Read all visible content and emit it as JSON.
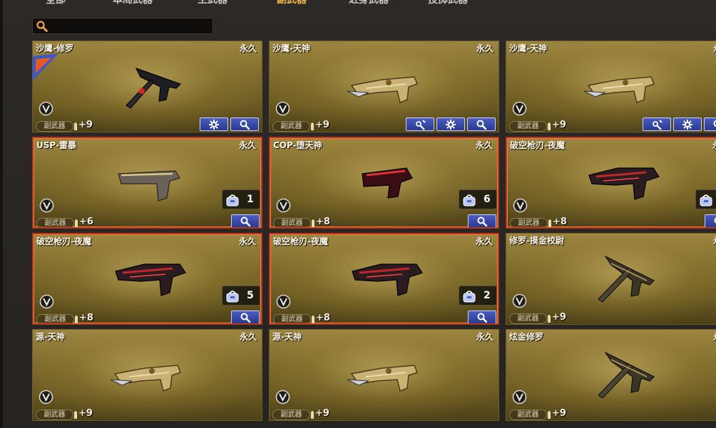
{
  "tabs": [
    {
      "label": "全部",
      "active": false
    },
    {
      "label": "本局武器",
      "active": false
    },
    {
      "label": "主武器",
      "active": false
    },
    {
      "label": "副武器",
      "active": true
    },
    {
      "label": "近身武器",
      "active": false
    },
    {
      "label": "投掷武器",
      "active": false
    }
  ],
  "search": {
    "placeholder": "",
    "value": ""
  },
  "cards": [
    {
      "name": "沙鹰-修罗",
      "duration": "永久",
      "type": "副武器",
      "level": "+9",
      "buttons": [
        "settings",
        "search"
      ],
      "red": false,
      "qty": null
    },
    {
      "name": "沙鹰-天神",
      "duration": "永久",
      "type": "副武器",
      "level": "+9",
      "buttons": [
        "wrench",
        "settings",
        "search"
      ],
      "red": false,
      "qty": null
    },
    {
      "name": "沙鹰-天神",
      "duration": "永久",
      "type": "副武器",
      "level": "+9",
      "buttons": [
        "wrench",
        "settings",
        "search"
      ],
      "red": false,
      "qty": null
    },
    {
      "name": "USP-雷暴",
      "duration": "永久",
      "type": "副武器",
      "level": "+6",
      "buttons": [
        "search"
      ],
      "red": true,
      "qty": "1"
    },
    {
      "name": "COP-堕天神",
      "duration": "永久",
      "type": "副武器",
      "level": "+8",
      "buttons": [
        "search"
      ],
      "red": true,
      "qty": "6"
    },
    {
      "name": "破空枪刃-夜魔",
      "duration": "永久",
      "type": "副武器",
      "level": "+8",
      "buttons": [
        "search"
      ],
      "red": true,
      "qty": ""
    },
    {
      "name": "破空枪刃-夜魔",
      "duration": "永久",
      "type": "副武器",
      "level": "+8",
      "buttons": [
        "search"
      ],
      "red": true,
      "qty": "5"
    },
    {
      "name": "破空枪刃-夜魔",
      "duration": "永久",
      "type": "副武器",
      "level": "+8",
      "buttons": [
        "search"
      ],
      "red": true,
      "qty": "2"
    },
    {
      "name": "修罗-摸金校尉",
      "duration": "永久",
      "type": "副武器",
      "level": "+9",
      "buttons": [],
      "red": false,
      "qty": null
    },
    {
      "name": "源-天神",
      "duration": "永久",
      "type": "副武器",
      "level": "+9",
      "buttons": [],
      "red": false,
      "qty": null
    },
    {
      "name": "源-天神",
      "duration": "永久",
      "type": "副武器",
      "level": "+9",
      "buttons": [],
      "red": false,
      "qty": null
    },
    {
      "name": "炫金修罗",
      "duration": "永久",
      "type": "副武器",
      "level": "+9",
      "buttons": [],
      "red": false,
      "qty": null
    }
  ],
  "colors": {
    "accent_tab": "#f2b84a",
    "card_border_red": "#b4381e",
    "button_blue": "#3a4aa8"
  }
}
